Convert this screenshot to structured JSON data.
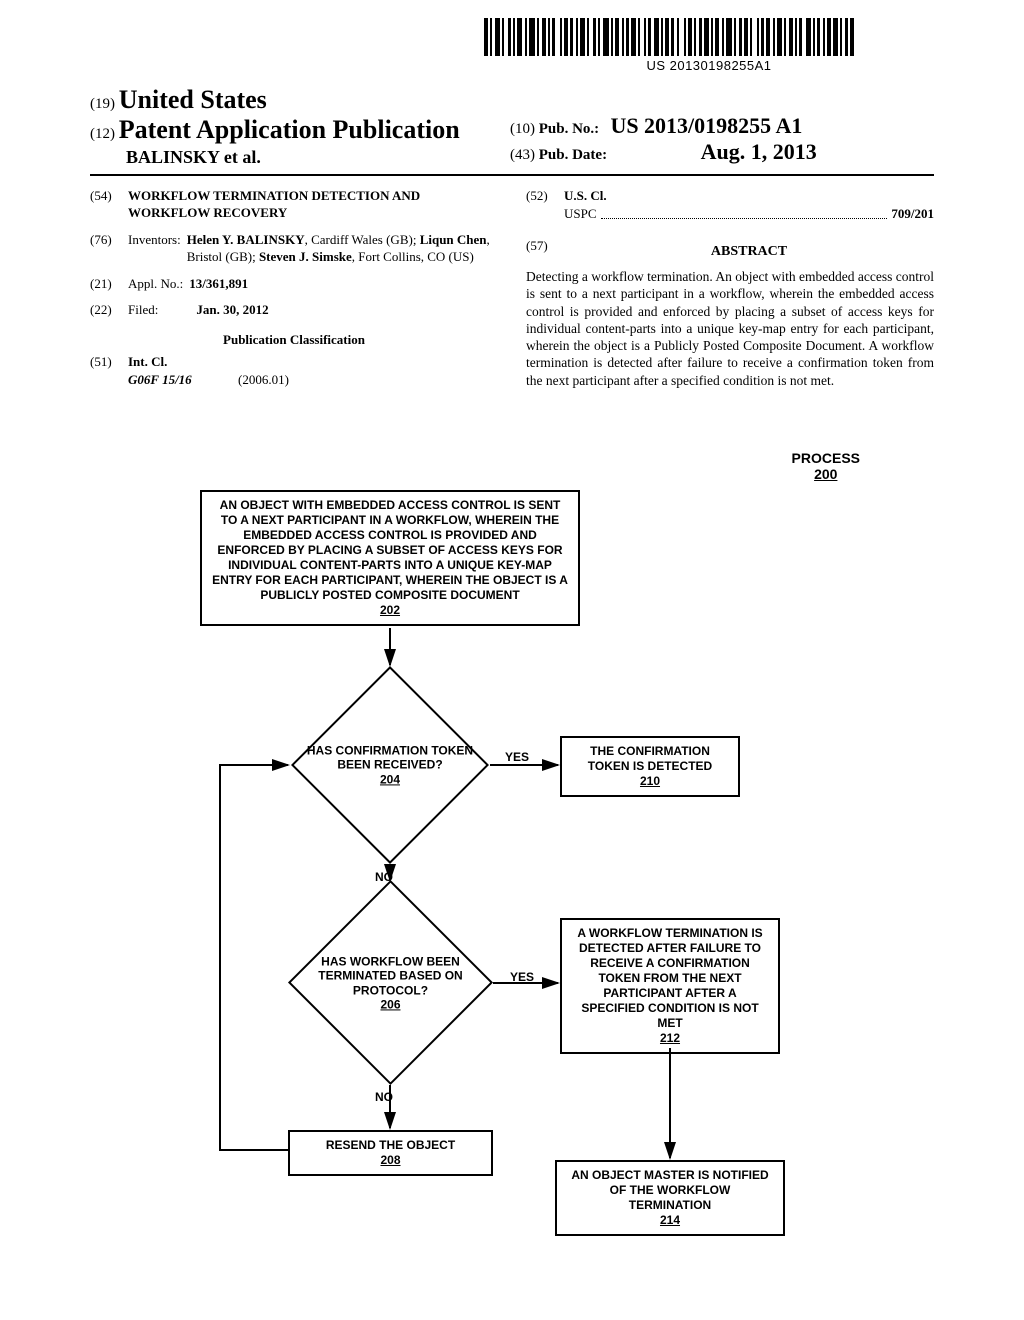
{
  "barcode_number": "US 20130198255A1",
  "header": {
    "code19": "(19)",
    "country": "United States",
    "code12": "(12)",
    "pub_type": "Patent Application Publication",
    "inventor_line": "BALINSKY  et al.",
    "code10": "(10)",
    "pubno_label": "Pub. No.:",
    "pubno": "US 2013/0198255 A1",
    "code43": "(43)",
    "pubdate_label": "Pub. Date:",
    "pubdate": "Aug. 1, 2013"
  },
  "bib": {
    "code54": "(54)",
    "title": "WORKFLOW TERMINATION DETECTION AND WORKFLOW RECOVERY",
    "code76": "(76)",
    "inventors_label": "Inventors:",
    "inventors_html": "Helen Y. BALINSKY, Cardiff Wales (GB); Liqun Chen, Bristol (GB); Steven J. Simske, Fort Collins, CO (US)",
    "code21": "(21)",
    "applno_label": "Appl. No.:",
    "applno": "13/361,891",
    "code22": "(22)",
    "filed_label": "Filed:",
    "filed": "Jan. 30, 2012",
    "pubclass_heading": "Publication Classification",
    "code51": "(51)",
    "intcl_label": "Int. Cl.",
    "intcl_sym": "G06F 15/16",
    "intcl_ver": "(2006.01)",
    "code52": "(52)",
    "uscl_label": "U.S. Cl.",
    "uspc_label": "USPC",
    "uspc_val": "709/201",
    "code57": "(57)",
    "abstract_heading": "ABSTRACT",
    "abstract_text": "Detecting a workflow termination. An object with embedded access control is sent to a next participant in a workflow, wherein the embedded access control is provided and enforced by placing a subset of access keys for individual content-parts into a unique key-map entry for each participant, wherein the object is a Publicly Posted Composite Document. A workflow termination is detected after failure to receive a confirmation token from the next participant after a specified condition is not met."
  },
  "flowchart": {
    "title": "PROCESS",
    "title_num": "200",
    "box202_text": "AN OBJECT WITH EMBEDDED ACCESS CONTROL IS SENT TO A NEXT PARTICIPANT IN A WORKFLOW, WHEREIN THE EMBEDDED ACCESS CONTROL IS PROVIDED AND ENFORCED BY PLACING A SUBSET OF ACCESS KEYS FOR INDIVIDUAL CONTENT-PARTS INTO A UNIQUE KEY-MAP ENTRY FOR EACH PARTICIPANT, WHEREIN THE OBJECT IS A PUBLICLY POSTED COMPOSITE DOCUMENT",
    "box202_num": "202",
    "d204_text": "HAS CONFIRMATION TOKEN BEEN RECEIVED?",
    "d204_num": "204",
    "d206_text": "HAS WORKFLOW BEEN TERMINATED BASED ON PROTOCOL?",
    "d206_num": "206",
    "box208_text": "RESEND THE OBJECT",
    "box208_num": "208",
    "box210_text": "THE CONFIRMATION TOKEN IS DETECTED",
    "box210_num": "210",
    "box212_text": "A WORKFLOW TERMINATION IS DETECTED AFTER FAILURE TO RECEIVE A CONFIRMATION TOKEN FROM THE NEXT PARTICIPANT AFTER A SPECIFIED CONDITION IS NOT MET",
    "box212_num": "212",
    "box214_text": "AN OBJECT MASTER IS NOTIFIED OF THE WORKFLOW TERMINATION",
    "box214_num": "214",
    "yes": "YES",
    "no": "NO"
  }
}
